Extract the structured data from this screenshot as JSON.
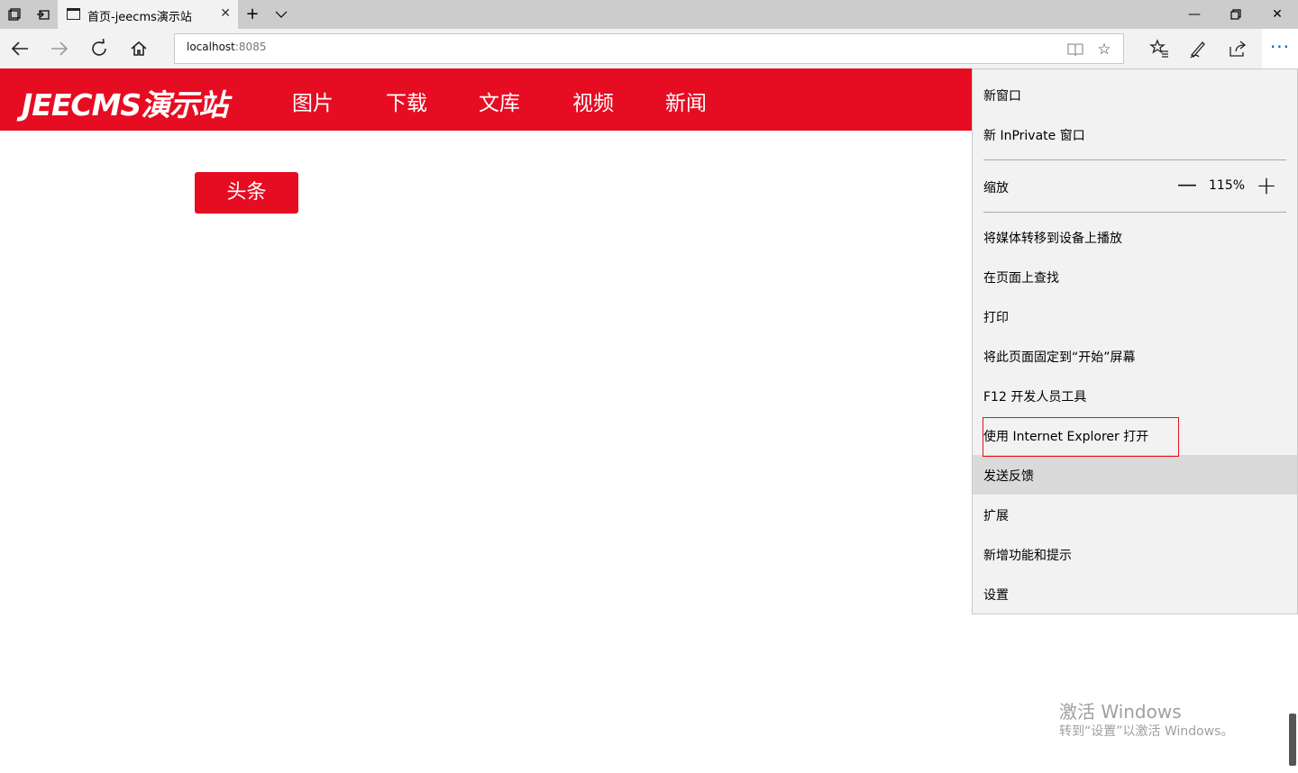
{
  "browser": {
    "tab_title": "首页-jeecms演示站",
    "address_host": "localhost",
    "address_port": ":8085",
    "more_glyph": "···"
  },
  "site": {
    "logo": "JEECMS演示站",
    "nav": [
      "图片",
      "下载",
      "文库",
      "视频",
      "新闻"
    ],
    "headline_button": "头条"
  },
  "menu": {
    "new_window": "新窗口",
    "new_inprivate": "新 InPrivate 窗口",
    "zoom_label": "缩放",
    "zoom_value": "115%",
    "cast_media": "将媒体转移到设备上播放",
    "find_on_page": "在页面上查找",
    "print": "打印",
    "pin_to_start": "将此页面固定到“开始”屏幕",
    "dev_tools": "F12 开发人员工具",
    "open_with_ie": "使用 Internet Explorer 打开",
    "send_feedback": "发送反馈",
    "extensions": "扩展",
    "whats_new": "新增功能和提示",
    "settings": "设置"
  },
  "watermark": {
    "title": "激活 Windows",
    "subtitle": "转到“设置”以激活 Windows。"
  },
  "colors": {
    "brand_red": "#e60c22",
    "accent_blue": "#0063b1",
    "highlight_border": "#e3141e"
  }
}
